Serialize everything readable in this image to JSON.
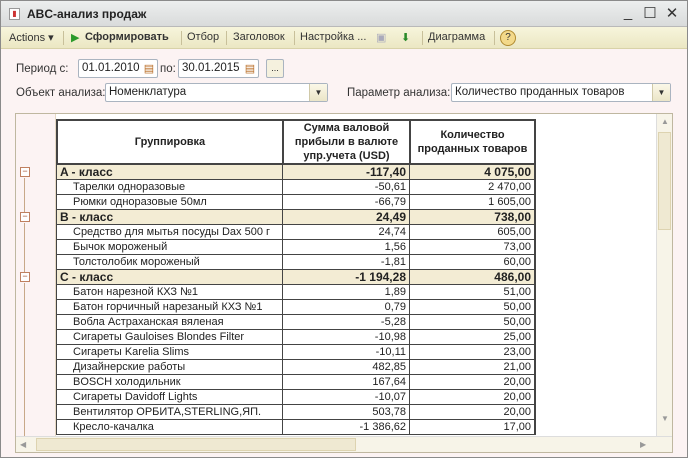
{
  "window": {
    "title": "ABC-анализ продаж",
    "minimize": "_",
    "maximize": "☐",
    "close": "✕"
  },
  "toolbar": {
    "actions": "Actions ▾",
    "generate": "Сформировать",
    "filter": "Отбор",
    "header": "Заголовок",
    "settings": "Настройка ...",
    "diagram": "Диаграмма",
    "help": "?"
  },
  "form": {
    "period_from_label": "Период с:",
    "period_from": "01.01.2010",
    "period_to_label": "по:",
    "period_to": "30.01.2015",
    "more": "...",
    "object_label": "Объект анализа:",
    "object_value": "Номенклатура",
    "param_label": "Параметр анализа:",
    "param_value": "Количество проданных товаров"
  },
  "table": {
    "headers": [
      "Группировка",
      "Сумма валовой прибыли в валюте упр.учета (USD)",
      "Количество проданных товаров"
    ],
    "rows": [
      {
        "type": "group",
        "name": "A - класс",
        "profit": "-117,40",
        "qty": "4 075,00"
      },
      {
        "type": "item",
        "name": "Тарелки одноразовые",
        "profit": "-50,61",
        "qty": "2 470,00"
      },
      {
        "type": "item",
        "name": "Рюмки одноразовые 50мл",
        "profit": "-66,79",
        "qty": "1 605,00"
      },
      {
        "type": "group",
        "name": "B - класс",
        "profit": "24,49",
        "qty": "738,00"
      },
      {
        "type": "item",
        "name": "Средство для мытья посуды Dax 500 г",
        "profit": "24,74",
        "qty": "605,00"
      },
      {
        "type": "item",
        "name": "Бычок мороженый",
        "profit": "1,56",
        "qty": "73,00"
      },
      {
        "type": "item",
        "name": "Толстолобик мороженый",
        "profit": "-1,81",
        "qty": "60,00"
      },
      {
        "type": "group",
        "name": "C - класс",
        "profit": "-1 194,28",
        "qty": "486,00"
      },
      {
        "type": "item",
        "name": "Батон нарезной КХЗ №1",
        "profit": "1,89",
        "qty": "51,00"
      },
      {
        "type": "item",
        "name": "Батон горчичный нарезаный КХЗ №1",
        "profit": "0,79",
        "qty": "50,00"
      },
      {
        "type": "item",
        "name": "Вобла Астраханская вяленая",
        "profit": "-5,28",
        "qty": "50,00"
      },
      {
        "type": "item",
        "name": "Сигареты Gauloises Blondes Filter",
        "profit": "-10,98",
        "qty": "25,00"
      },
      {
        "type": "item",
        "name": "Сигареты Karelia Slims",
        "profit": "-10,11",
        "qty": "23,00"
      },
      {
        "type": "item",
        "name": "Дизайнерские работы",
        "profit": "482,85",
        "qty": "21,00"
      },
      {
        "type": "item",
        "name": "BOSCH холодильник",
        "profit": "167,64",
        "qty": "20,00"
      },
      {
        "type": "item",
        "name": "Сигареты Davidoff Lights",
        "profit": "-10,07",
        "qty": "20,00"
      },
      {
        "type": "item",
        "name": "Вентилятор ОРБИТА,STERLING,ЯП.",
        "profit": "503,78",
        "qty": "20,00"
      },
      {
        "type": "item",
        "name": "Кресло-качалка",
        "profit": "-1 386,62",
        "qty": "17,00"
      }
    ]
  }
}
